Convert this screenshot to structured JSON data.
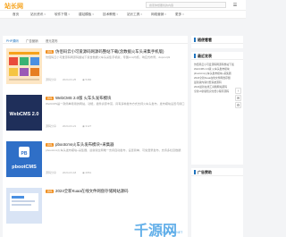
{
  "header": {
    "logo": "站长网",
    "search_placeholder": "搜索你想要找的内容",
    "menu_icon": "menu-icon"
  },
  "nav": {
    "items": [
      {
        "label": "首页"
      },
      {
        "label": "站长资讯"
      },
      {
        "label": "软件下载"
      },
      {
        "label": "建站模板"
      },
      {
        "label": "技术教程"
      },
      {
        "label": "站长工具"
      },
      {
        "label": "网络营销"
      },
      {
        "label": "更多"
      }
    ]
  },
  "tabs": [
    {
      "label": "PHP源码"
    },
    {
      "label": "广告营销"
    },
    {
      "label": "首元发布"
    }
  ],
  "articles": [
    {
      "tag": "源码",
      "title": "仿佰码云小可爱源码网源码整站下载(含数据火车头采集手机版)",
      "desc": "仿佰码云小可爱源码网源码整站下载含数据火车头采集手机版，帝国cms内核，响应式布局，dopcorp9",
      "author": "源码分享",
      "date": "2024-03-25",
      "views": "5482"
    },
    {
      "tag": "源码",
      "title": "WebCMS 2.0版 火车头发布模块",
      "desc": "WebCMS是一款简单易用的网站，功能，插件资源丰富，具有多种发布方式支持火车头发布，发布模块设置与接口",
      "author": "源码分享",
      "date": "2024-03-21",
      "views": "3127"
    },
    {
      "tag": "源码",
      "title": "pbootcms火车头发布模块+采集器",
      "desc": "pbootcms火车头发布模块+采集器，最新版全网唯一支持自动发布，设置简单，可免登录发布，支持多栏目数据",
      "author": "源码分享",
      "date": "2024-03-18",
      "views": "2861"
    },
    {
      "tag": "源码",
      "title": "2024全新Kuaa在线文件网盘存储网站源码",
      "desc": "",
      "author": "",
      "date": "",
      "views": ""
    }
  ],
  "thumb_text": {
    "webcms": "WebCMS 2.0",
    "pboot_logo": "PB",
    "pboot_name": "pbootCMS"
  },
  "sidebar": {
    "widget1_title": "随便看看",
    "widget2_title": "最近发表",
    "widget2_items": [
      "仿佰码云小可爱源码网源码整站下载",
      "WebCMS 2.0版 火车头发布模块",
      "pbootcms火车头发布模块+采集器",
      "2024全新Kuaa在线文件网盘存储",
      "最新版内容付费系统源码",
      "2024最新在线工具箱网站源码",
      "全新UI新版知识付费小程序源码"
    ],
    "widget3_title": "广告赞助"
  },
  "fabs": [
    "↑",
    "✉",
    "⚙"
  ],
  "watermark": {
    "main": "千源网",
    "sub": "QIANYUAN.NET"
  },
  "colors": {
    "accent": "#1e73be",
    "tag": "#f08c1a",
    "logo": "#f6a21a"
  }
}
